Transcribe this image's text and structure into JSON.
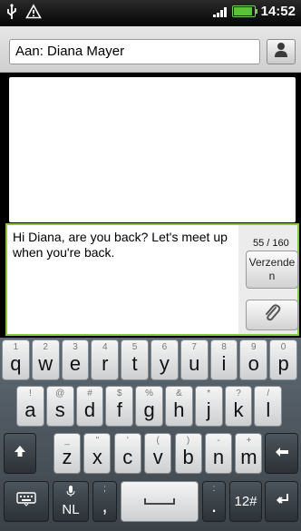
{
  "status_bar": {
    "time": "14:52",
    "icons": [
      "usb-icon",
      "warning-icon",
      "signal-icon",
      "battery-icon"
    ],
    "battery_color": "#5bc236"
  },
  "compose": {
    "recipient": "Aan: Diana Mayer",
    "message": "Hi Diana, are you back? Let's meet up when you're back.",
    "char_count": "55 / 160",
    "send_label": "Verzenden",
    "attach_icon": "paperclip-icon",
    "border_color": "#86c83f"
  },
  "keyboard": {
    "row1": [
      {
        "main": "q",
        "alt": "1"
      },
      {
        "main": "w",
        "alt": "2"
      },
      {
        "main": "e",
        "alt": "3"
      },
      {
        "main": "r",
        "alt": "4"
      },
      {
        "main": "t",
        "alt": "5"
      },
      {
        "main": "y",
        "alt": "6"
      },
      {
        "main": "u",
        "alt": "7"
      },
      {
        "main": "i",
        "alt": "8"
      },
      {
        "main": "o",
        "alt": "9"
      },
      {
        "main": "p",
        "alt": "0"
      }
    ],
    "row2": [
      {
        "main": "a",
        "alt": "!"
      },
      {
        "main": "s",
        "alt": "@"
      },
      {
        "main": "d",
        "alt": "#"
      },
      {
        "main": "f",
        "alt": "$"
      },
      {
        "main": "g",
        "alt": "%"
      },
      {
        "main": "h",
        "alt": "&"
      },
      {
        "main": "j",
        "alt": "*"
      },
      {
        "main": "k",
        "alt": "?"
      },
      {
        "main": "l",
        "alt": "/"
      }
    ],
    "row3": [
      {
        "main": "z",
        "alt": "_"
      },
      {
        "main": "x",
        "alt": "\""
      },
      {
        "main": "c",
        "alt": "'"
      },
      {
        "main": "v",
        "alt": "("
      },
      {
        "main": "b",
        "alt": ")"
      },
      {
        "main": "n",
        "alt": "-"
      },
      {
        "main": "m",
        "alt": "+"
      }
    ],
    "lang_label": "NL",
    "comma_main": ",",
    "comma_alt": ";",
    "period_main": ".",
    "period_alt": ":",
    "symbols_label": "12#"
  }
}
